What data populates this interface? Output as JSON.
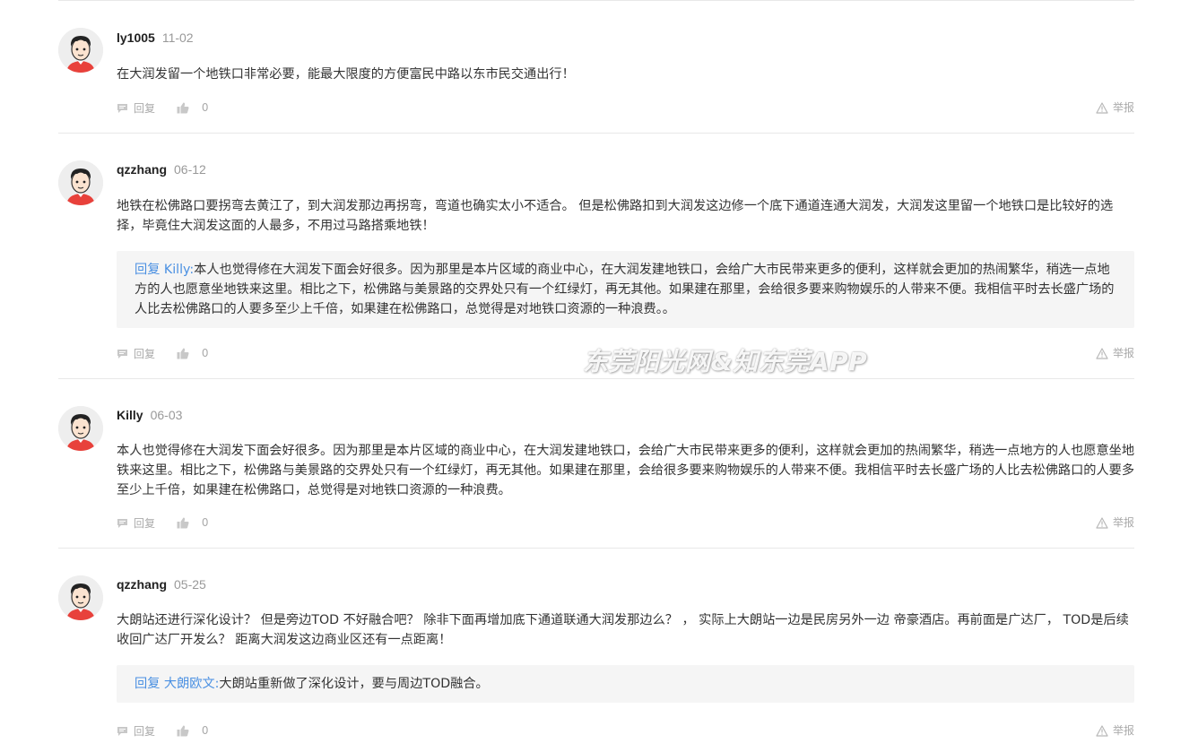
{
  "comments": [
    {
      "username": "ly1005",
      "date": "11-02",
      "text": "在大润发留一个地铁口非常必要，能最大限度的方便富民中路以东市民交通出行！",
      "reply_label": "回复",
      "likes": "0",
      "report_label": "举报"
    },
    {
      "username": "qzzhang",
      "date": "06-12",
      "text": "地铁在松佛路口要拐弯去黄江了，到大润发那边再拐弯，弯道也确实太小不适合。 但是松佛路扣到大润发这边修一个底下通道连通大润发，大润发这里留一个地铁口是比较好的选择，毕竟住大润发这面的人最多，不用过马路搭乘地铁！",
      "quote": {
        "label": "回复 Killy:",
        "text": "本人也觉得修在大润发下面会好很多。因为那里是本片区域的商业中心，在大润发建地铁口，会给广大市民带来更多的便利，这样就会更加的热闹繁华，稍选一点地方的人也愿意坐地铁来这里。相比之下，松佛路与美景路的交界处只有一个红绿灯，再无其他。如果建在那里，会给很多要来购物娱乐的人带来不便。我相信平时去长盛广场的人比去松佛路口的人要多至少上千倍，如果建在松佛路口，总觉得是对地铁口资源的一种浪费。。"
      },
      "reply_label": "回复",
      "likes": "0",
      "report_label": "举报"
    },
    {
      "username": "Killy",
      "date": "06-03",
      "text": "本人也觉得修在大润发下面会好很多。因为那里是本片区域的商业中心，在大润发建地铁口，会给广大市民带来更多的便利，这样就会更加的热闹繁华，稍选一点地方的人也愿意坐地铁来这里。相比之下，松佛路与美景路的交界处只有一个红绿灯，再无其他。如果建在那里，会给很多要来购物娱乐的人带来不便。我相信平时去长盛广场的人比去松佛路口的人要多至少上千倍，如果建在松佛路口，总觉得是对地铁口资源的一种浪费。",
      "reply_label": "回复",
      "likes": "0",
      "report_label": "举报"
    },
    {
      "username": "qzzhang",
      "date": "05-25",
      "text": "大朗站还进行深化设计？ 但是旁边TOD 不好融合吧？ 除非下面再增加底下通道联通大润发那边么？ ， 实际上大朗站一边是民房另外一边 帝豪酒店。再前面是广达厂， TOD是后续收回广达厂开发么？ 距离大润发这边商业区还有一点距离！",
      "quote": {
        "label": "回复 大朗欧文:",
        "text": "大朗站重新做了深化设计，要与周边TOD融合。"
      },
      "reply_label": "回复",
      "likes": "0",
      "report_label": "举报"
    }
  ],
  "watermark": "东莞阳光网&知东莞APP",
  "icons": {
    "reply": "comment-bubble-icon",
    "like": "thumbs-up-icon",
    "report": "warning-triangle-icon",
    "avatar": "default-user-avatar"
  },
  "colors": {
    "reply_label": "#4a90e2",
    "quote_bg": "#f5f5f5",
    "avatar_shirt": "#e8413b",
    "muted": "#999999"
  }
}
